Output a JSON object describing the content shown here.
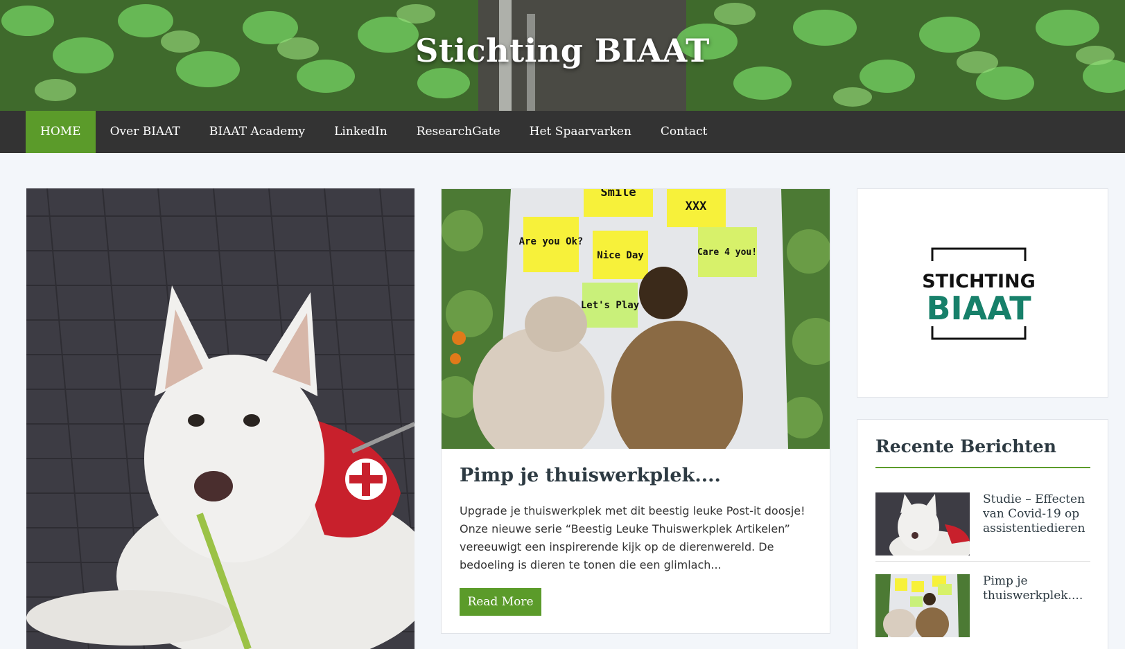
{
  "site": {
    "title": "Stichting BIAAT"
  },
  "nav": {
    "items": [
      {
        "label": "HOME"
      },
      {
        "label": "Over BIAAT"
      },
      {
        "label": "BIAAT Academy"
      },
      {
        "label": "LinkedIn"
      },
      {
        "label": "ResearchGate"
      },
      {
        "label": "Het Spaarvarken"
      },
      {
        "label": "Contact"
      }
    ]
  },
  "posts": {
    "featured": {
      "title": "Pimp je thuiswerkplek....",
      "excerpt": "Upgrade je thuiswerkplek met dit beestig leuke Post-it doosje! Onze nieuwe serie “Beestig Leuke Thuiswerkplek Artikelen” vereeuwigt een inspirerende kijk op de dierenwereld. De bedoeling is dieren te tonen die een glimlach...",
      "read_more": "Read More",
      "notes": [
        "Smile",
        "XXX",
        "Are you Ok?",
        "Nice Day",
        "Care 4 you!",
        "Let's Play"
      ]
    }
  },
  "sidebar": {
    "logo": {
      "line1": "STICHTING",
      "line2": "BIAAT"
    },
    "recent": {
      "title": "Recente Berichten",
      "items": [
        {
          "label": "Studie – Effecten van Covid-19 op assistentiedieren"
        },
        {
          "label": "Pimp je thuiswerkplek...."
        }
      ]
    }
  },
  "colors": {
    "accent": "#5b9b2a",
    "nav_bg": "#333333",
    "page_bg": "#f3f6fa",
    "logo_green": "#17806a"
  }
}
